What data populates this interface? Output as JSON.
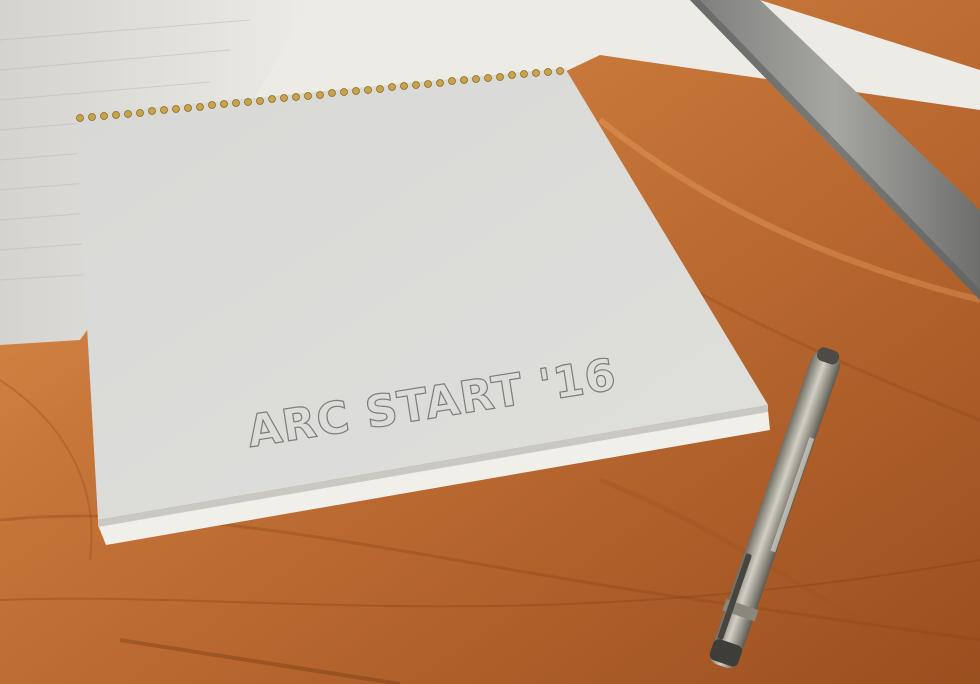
{
  "scene": {
    "description_free": true,
    "cover_text": "ARC START  '16",
    "objects": {
      "table": "wood-table",
      "paper_sheet": "paper-sheet",
      "notebook": "notebook",
      "ruler": "metal-ruler",
      "pen": "pen"
    },
    "colors": {
      "wood_light": "#d98a44",
      "wood_mid": "#b8642a",
      "wood_dark": "#8a4418",
      "paper": "#e9e7e2",
      "cover": "#dcdcd8",
      "cover_edge": "#f2f1ec",
      "binding_ring": "#c9a24a",
      "ruler_metal": "#9c9c98",
      "pen_body": "#b0aca0"
    }
  }
}
